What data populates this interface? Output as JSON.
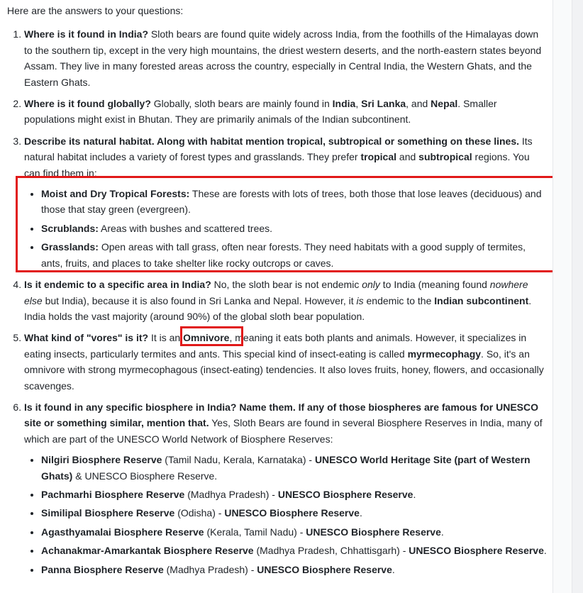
{
  "intro": "Here are the answers to your questions:",
  "q1": {
    "question": "Where is it found in India?",
    "answer": " Sloth bears are found quite widely across India, from the foothills of the Himalayas down to the southern tip, except in the very high mountains, the driest western deserts, and the north-eastern states beyond Assam. They live in many forested areas across the country, especially in Central India, the Western Ghats, and the Eastern Ghats."
  },
  "q2": {
    "question": "Where is it found globally?",
    "a1": " Globally, sloth bears are mainly found in ",
    "india": "India",
    "c1": ", ",
    "sri_lanka": "Sri Lanka",
    "c2": ", and ",
    "nepal": "Nepal",
    "a2": ". Smaller populations might exist in Bhutan. They are primarily animals of the Indian subcontinent."
  },
  "q3": {
    "question": "Describe its natural habitat. Along with habitat mention tropical, subtropical or something on these lines.",
    "a1": " Its natural habitat includes a variety of forest types and grasslands. They prefer ",
    "tropical": "tropical",
    "a2": " and ",
    "subtropical": "subtropical",
    "a3": " regions. You can find them in:",
    "items": [
      {
        "term": "Moist and Dry Tropical Forests:",
        "desc": " These are forests with lots of trees, both those that lose leaves (deciduous) and those that stay green (evergreen)."
      },
      {
        "term": "Scrublands:",
        "desc": " Areas with bushes and scattered trees."
      },
      {
        "term": "Grasslands:",
        "desc": " Open areas with tall grass, often near forests. They need habitats with a good supply of termites, ants, fruits, and places to take shelter like rocky outcrops or caves."
      }
    ]
  },
  "q4": {
    "question": "Is it endemic to a specific area in India?",
    "a1": " No, the sloth bear is not endemic ",
    "only": "only",
    "a2": " to India (meaning found ",
    "nowhere_else": "nowhere else",
    "a3": " but India), because it is also found in Sri Lanka and Nepal. However, it ",
    "is": "is",
    "a4": " endemic to the ",
    "indian_subcontinent": "Indian subcontinent",
    "a5": ". India holds the vast majority (around 90%) of the global sloth bear population."
  },
  "q5": {
    "question": "What kind of \"vores\" is it?",
    "a1": " It is an ",
    "omnivore": "Omnivore",
    "a2": ", meaning it eats both plants and animals. However, it specializes in eating insects, particularly termites and ants. This special kind of insect-eating is called ",
    "myrmecophagy": "myrmecophagy",
    "a3": ". So, it's an omnivore with strong myrmecophagous (insect-eating) tendencies. It also loves fruits, honey, flowers, and occasionally scavenges."
  },
  "q6": {
    "question": "Is it found in any specific biosphere in India? Name them. If any of those biospheres are famous for UNESCO site or something similar, mention that.",
    "answer": " Yes, Sloth Bears are found in several Biosphere Reserves in India, many of which are part of the UNESCO World Network of Biosphere Reserves:",
    "reserves": [
      {
        "name": "Nilgiri Biosphere Reserve",
        "region": " (Tamil Nadu, Kerala, Karnataka) - ",
        "status": "UNESCO World Heritage Site (part of Western Ghats)",
        "tail": " & UNESCO Biosphere Reserve."
      },
      {
        "name": "Pachmarhi Biosphere Reserve",
        "region": " (Madhya Pradesh) - ",
        "status": "UNESCO Biosphere Reserve",
        "tail": "."
      },
      {
        "name": "Similipal Biosphere Reserve",
        "region": " (Odisha) - ",
        "status": "UNESCO Biosphere Reserve",
        "tail": "."
      },
      {
        "name": "Agasthyamalai Biosphere Reserve",
        "region": " (Kerala, Tamil Nadu) - ",
        "status": "UNESCO Biosphere Reserve",
        "tail": "."
      },
      {
        "name": "Achanakmar-Amarkantak Biosphere Reserve",
        "region": " (Madhya Pradesh, Chhattisgarh) - ",
        "status": "UNESCO Biosphere Reserve",
        "tail": "."
      },
      {
        "name": "Panna Biosphere Reserve",
        "region": " (Madhya Pradesh) - ",
        "status": "UNESCO Biosphere Reserve",
        "tail": "."
      }
    ]
  },
  "colors": {
    "highlight": "#e11919",
    "text": "#1f2328"
  }
}
